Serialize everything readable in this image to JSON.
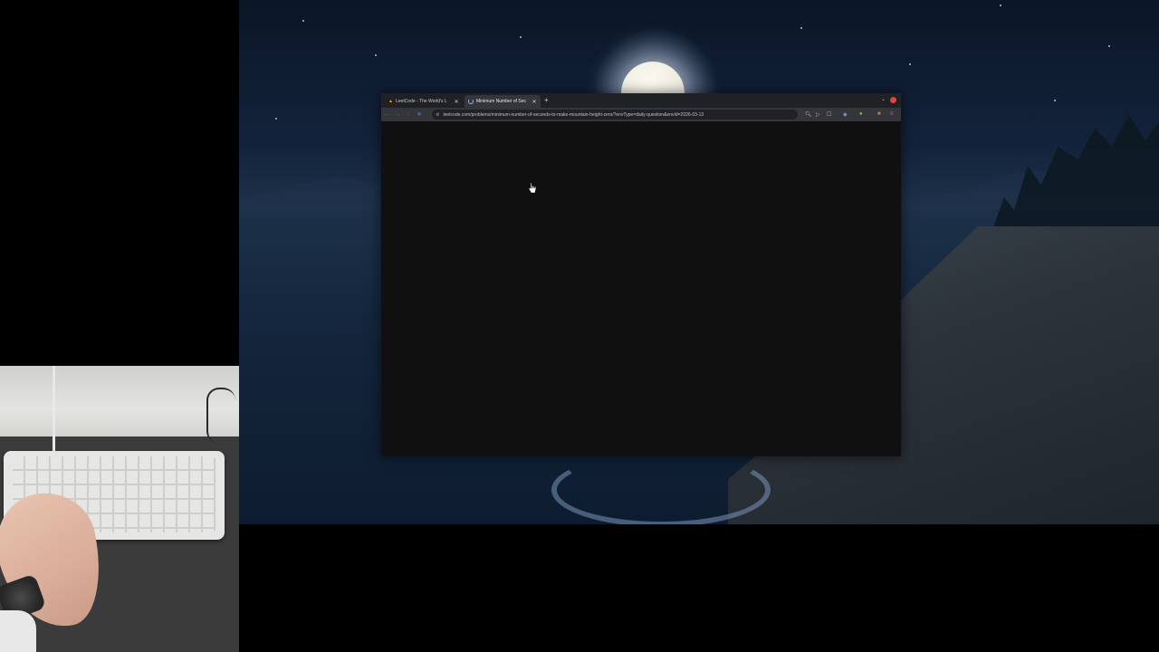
{
  "browser": {
    "tabs": [
      {
        "title": "LeetCode - The World's L",
        "favicon": "leetcode-icon",
        "active": false
      },
      {
        "title": "Minimum Number of Sec",
        "favicon": "loading-spinner-icon",
        "active": true
      }
    ],
    "new_tab_symbol": "+",
    "address_bar": {
      "url": "leetcode.com/problems/minimum-number-of-seconds-to-make-mountain-height-zero/?envType=daily-question&envId=2026-03-13"
    },
    "nav_icons": [
      "back-icon",
      "forward-icon",
      "reload-icon",
      "home-icon"
    ],
    "toolbar_icons": [
      "zoom-icon",
      "cast-icon",
      "bookmark-icon",
      "extension-icon",
      "profile-icon",
      "menu-icon"
    ]
  },
  "page": {
    "content_state": "blank-loading",
    "background_color": "#101010"
  },
  "colors": {
    "tabstrip": "#202124",
    "toolbar": "#35363a",
    "window_close": "#e0443e"
  }
}
